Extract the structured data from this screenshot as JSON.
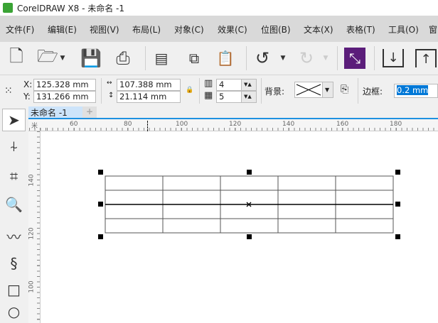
{
  "title": "CorelDRAW X8 - 未命名 -1",
  "menu": [
    "文件(F)",
    "编辑(E)",
    "视图(V)",
    "布局(L)",
    "对象(C)",
    "效果(C)",
    "位图(B)",
    "文本(X)",
    "表格(T)",
    "工具(O)",
    "窗"
  ],
  "props": {
    "x_label": "X:",
    "x": "125.328 mm",
    "y_label": "Y:",
    "y": "131.266 mm",
    "w": "107.388 mm",
    "h": "21.114 mm",
    "cols": "4",
    "rows": "5",
    "bg_label": "背景:",
    "border_label": "边框:",
    "border": "0.2 mm"
  },
  "doc_tab": "未命名 -1",
  "new_tab": "+",
  "hruler": [
    "60",
    "80",
    "100",
    "120",
    "140",
    "160",
    "180"
  ],
  "vruler": [
    "140",
    "120",
    "100"
  ],
  "ruler_unit": "米",
  "colors": {
    "accent": "#1e90e0",
    "toolbar_bg": "#f0f0f0",
    "menu_bg": "#d9d9d9",
    "purple": "#5b1d7a"
  }
}
